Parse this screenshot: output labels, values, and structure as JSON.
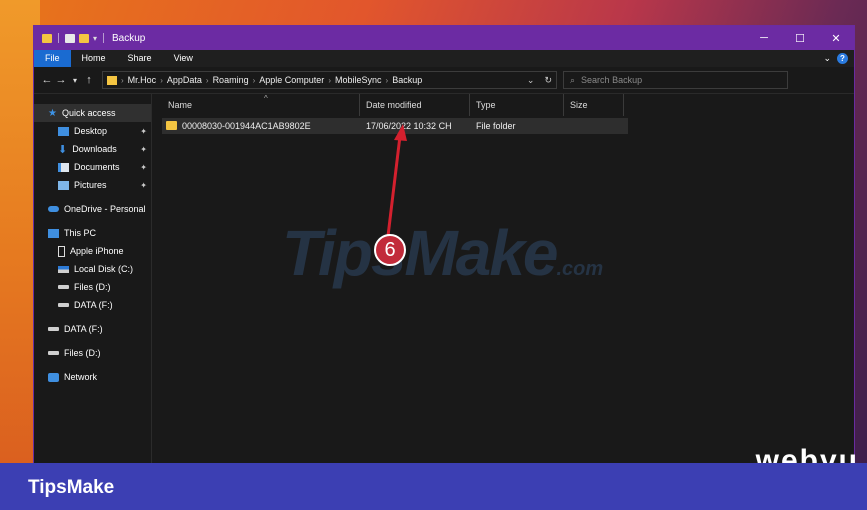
{
  "window": {
    "title": "Backup",
    "controls": {
      "minimize": "─",
      "maximize": "☐",
      "close": "✕"
    }
  },
  "ribbon": {
    "tabs": [
      "File",
      "Home",
      "Share",
      "View"
    ],
    "expand_glyph": "⌄",
    "help_glyph": "?"
  },
  "navigation": {
    "back": "←",
    "forward": "→",
    "recent": "▾",
    "up": "↑"
  },
  "address": {
    "crumbs": [
      "Mr.Hoc",
      "AppData",
      "Roaming",
      "Apple Computer",
      "MobileSync",
      "Backup"
    ],
    "separator": "›",
    "dropdown": "⌄",
    "refresh": "↻"
  },
  "search": {
    "placeholder": "Search Backup",
    "icon": "search-icon"
  },
  "sidebar": {
    "quick_access": "Quick access",
    "desktop": "Desktop",
    "downloads": "Downloads",
    "documents": "Documents",
    "pictures": "Pictures",
    "onedrive": "OneDrive - Personal",
    "this_pc": "This PC",
    "apple_iphone": "Apple iPhone",
    "local_disk": "Local Disk (C:)",
    "files_d_sub": "Files (D:)",
    "data_f_sub": "DATA (F:)",
    "data_f": "DATA (F:)",
    "files_d": "Files (D:)",
    "network": "Network",
    "pin_glyph": "📌"
  },
  "columns": {
    "name": "Name",
    "date_modified": "Date modified",
    "type": "Type",
    "size": "Size"
  },
  "files": [
    {
      "name": "00008030-001944AC1AB9802E",
      "date_modified": "17/06/2022 10:32 CH",
      "type": "File folder",
      "size": ""
    }
  ],
  "watermark": {
    "text": "TipsMake",
    "suffix": ".com"
  },
  "annotation": {
    "step": "6",
    "color": "#c22b3a"
  },
  "footer": {
    "brand": "TipsMake",
    "color": "#3c3fb3"
  },
  "corner_text": "webvu"
}
